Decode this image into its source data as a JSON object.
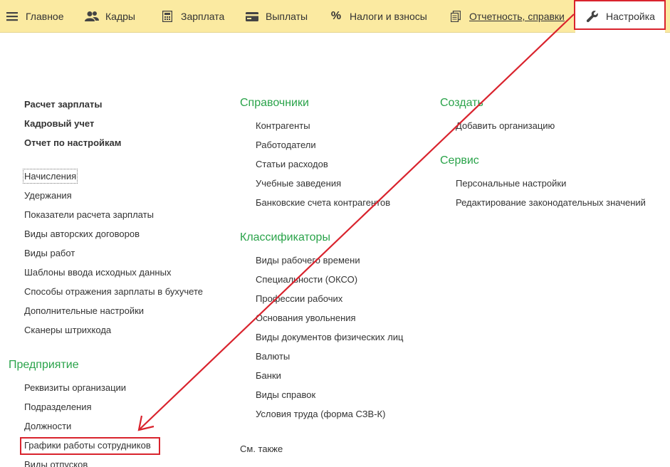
{
  "topbar": {
    "items": [
      {
        "label": "Главное",
        "icon": "hamburger-icon"
      },
      {
        "label": "Кадры",
        "icon": "people-icon"
      },
      {
        "label": "Зарплата",
        "icon": "calculator-icon"
      },
      {
        "label": "Выплаты",
        "icon": "card-icon"
      },
      {
        "label": "Налоги и взносы",
        "icon": "percent-icon"
      },
      {
        "label": "Отчетность, справки",
        "icon": "documents-icon"
      },
      {
        "label": "Настройка",
        "icon": "wrench-icon"
      }
    ]
  },
  "col1": {
    "bold_links": [
      "Расчет зарплаты",
      "Кадровый учет",
      "Отчет по настройкам"
    ],
    "links": [
      "Начисления",
      "Удержания",
      "Показатели расчета зарплаты",
      "Виды авторских договоров",
      "Виды работ",
      "Шаблоны ввода исходных данных",
      "Способы отражения зарплаты в бухучете",
      "Дополнительные настройки",
      "Сканеры штрихкода"
    ],
    "enterprise": {
      "title": "Предприятие",
      "links": [
        "Реквизиты организации",
        "Подразделения",
        "Должности",
        "Графики работы сотрудников",
        "Виды отпусков"
      ]
    }
  },
  "col2": {
    "sections": [
      {
        "title": "Справочники",
        "links": [
          "Контрагенты",
          "Работодатели",
          "Статьи расходов",
          "Учебные заведения",
          "Банковские счета контрагентов"
        ]
      },
      {
        "title": "Классификаторы",
        "links": [
          "Виды рабочего времени",
          "Специальности (ОКСО)",
          "Профессии рабочих",
          "Основания увольнения",
          "Виды документов физических лиц",
          "Валюты",
          "Банки",
          "Виды справок",
          "Условия труда (форма СЗВ-К)"
        ]
      }
    ],
    "see_also": "См. также"
  },
  "col3": {
    "sections": [
      {
        "title": "Создать",
        "links": [
          "Добавить организацию"
        ]
      },
      {
        "title": "Сервис",
        "links": [
          "Персональные настройки",
          "Редактирование законодательных значений"
        ]
      }
    ]
  },
  "colors": {
    "menu_bg": "#fbeaa1",
    "section_green": "#2aa34a",
    "highlight_red": "#d9232d",
    "text": "#333333"
  }
}
